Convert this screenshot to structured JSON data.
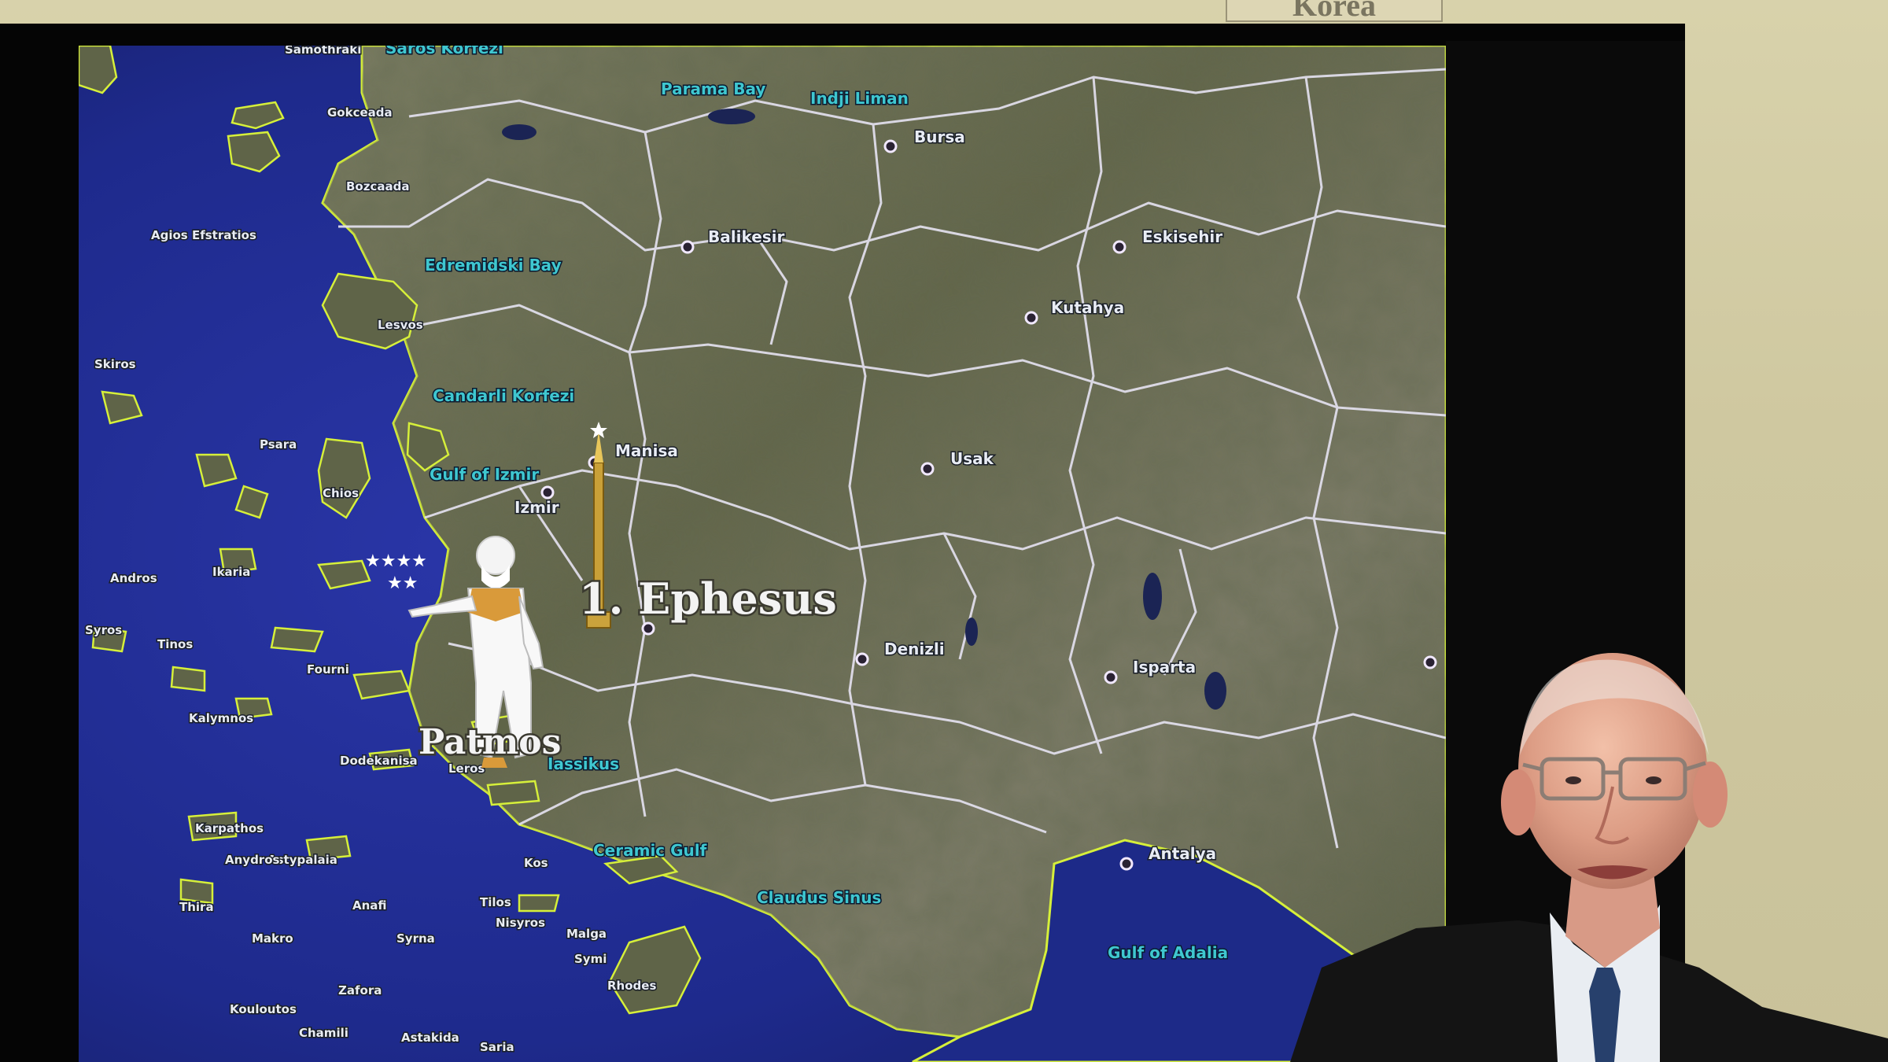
{
  "wall_sign": {
    "text": "Korea"
  },
  "map": {
    "highlight": "1. Ephesus",
    "island_label": "Patmos",
    "cities": [
      {
        "name": "Bursa"
      },
      {
        "name": "Balikesir"
      },
      {
        "name": "Eskisehir"
      },
      {
        "name": "Kutahya"
      },
      {
        "name": "Manisa"
      },
      {
        "name": "Izmir"
      },
      {
        "name": "Usak"
      },
      {
        "name": "Denizli"
      },
      {
        "name": "Isparta"
      },
      {
        "name": "Antalya"
      }
    ],
    "water_labels": [
      {
        "name": "Saros Korfezi"
      },
      {
        "name": "Parama Bay"
      },
      {
        "name": "Indji Liman"
      },
      {
        "name": "Edremidski Bay"
      },
      {
        "name": "Candarli Korfezi"
      },
      {
        "name": "Gulf of Izmir"
      },
      {
        "name": "Ceramic Gulf"
      },
      {
        "name": "Claudus Sinus"
      },
      {
        "name": "Gulf of Adalia"
      },
      {
        "name": "Iassikus"
      }
    ],
    "island_labels": [
      {
        "name": "Samothraki"
      },
      {
        "name": "Gokceada"
      },
      {
        "name": "Bozcaada"
      },
      {
        "name": "Agios Efstratios"
      },
      {
        "name": "Lesvos"
      },
      {
        "name": "Skiros"
      },
      {
        "name": "Psara"
      },
      {
        "name": "Chios"
      },
      {
        "name": "Andros"
      },
      {
        "name": "Tinos"
      },
      {
        "name": "Syros"
      },
      {
        "name": "Ikaria"
      },
      {
        "name": "Fourni"
      },
      {
        "name": "Kalymnos"
      },
      {
        "name": "Leros"
      },
      {
        "name": "Kos"
      },
      {
        "name": "Symi"
      },
      {
        "name": "Rhodes"
      },
      {
        "name": "Astypalaia"
      },
      {
        "name": "Anafi"
      },
      {
        "name": "Thira"
      },
      {
        "name": "Karpathos"
      },
      {
        "name": "Tilos"
      },
      {
        "name": "Nisyros"
      },
      {
        "name": "Dodekanisa"
      },
      {
        "name": "Anydros"
      },
      {
        "name": "Makro"
      },
      {
        "name": "Syrna"
      },
      {
        "name": "Zafora"
      },
      {
        "name": "Kouloutos"
      },
      {
        "name": "Chamili"
      },
      {
        "name": "Astakida"
      },
      {
        "name": "Saria"
      },
      {
        "name": "Malga"
      }
    ]
  },
  "colors": {
    "sea": "#1e2a8c",
    "land": "#6b6d52",
    "border": "#e6e3f2",
    "coast": "#d6ef3a",
    "screen": "#050505",
    "wall": "#d8d2ab"
  }
}
